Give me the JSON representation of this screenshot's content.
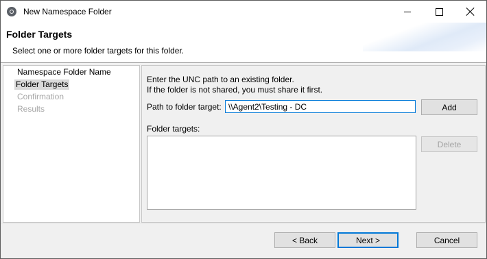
{
  "window": {
    "title": "New Namespace Folder"
  },
  "header": {
    "title": "Folder Targets",
    "description": "Select one or more folder targets for this folder."
  },
  "nav": {
    "items": [
      {
        "label": "Namespace Folder Name",
        "state": "normal"
      },
      {
        "label": "Folder Targets",
        "state": "selected"
      },
      {
        "label": "Confirmation",
        "state": "disabled"
      },
      {
        "label": "Results",
        "state": "disabled"
      }
    ]
  },
  "content": {
    "instruction_line1": "Enter the UNC path to an existing folder.",
    "instruction_line2": "If the folder is not shared, you must share it first.",
    "path_label": "Path to folder target:",
    "path_value": "\\\\Agent2\\Testing - DC",
    "add_label": "Add",
    "targets_label": "Folder targets:",
    "delete_label": "Delete",
    "targets": []
  },
  "footer": {
    "back_label": "< Back",
    "next_label": "Next >",
    "cancel_label": "Cancel"
  },
  "colors": {
    "focus_border": "#0078d7",
    "disabled_text": "#a6a6a6",
    "selection_bg": "#d9d9d9"
  }
}
